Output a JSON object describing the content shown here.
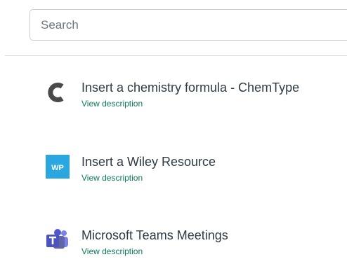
{
  "search": {
    "placeholder": "Search"
  },
  "tools": [
    {
      "title": "Insert a chemistry formula - ChemType",
      "description_link": "View description",
      "icon": "chemtype-icon"
    },
    {
      "title": "Insert a Wiley Resource",
      "description_link": "View description",
      "icon": "wiley-icon",
      "icon_text": "WP",
      "icon_color": "#2aa6e0"
    },
    {
      "title": "Microsoft Teams Meetings",
      "description_link": "View description",
      "icon": "microsoft-teams-icon",
      "icon_color": "#5059c9"
    }
  ],
  "colors": {
    "link": "#0a7a5a",
    "text": "#2d3b45",
    "border": "#c7cdd1"
  }
}
